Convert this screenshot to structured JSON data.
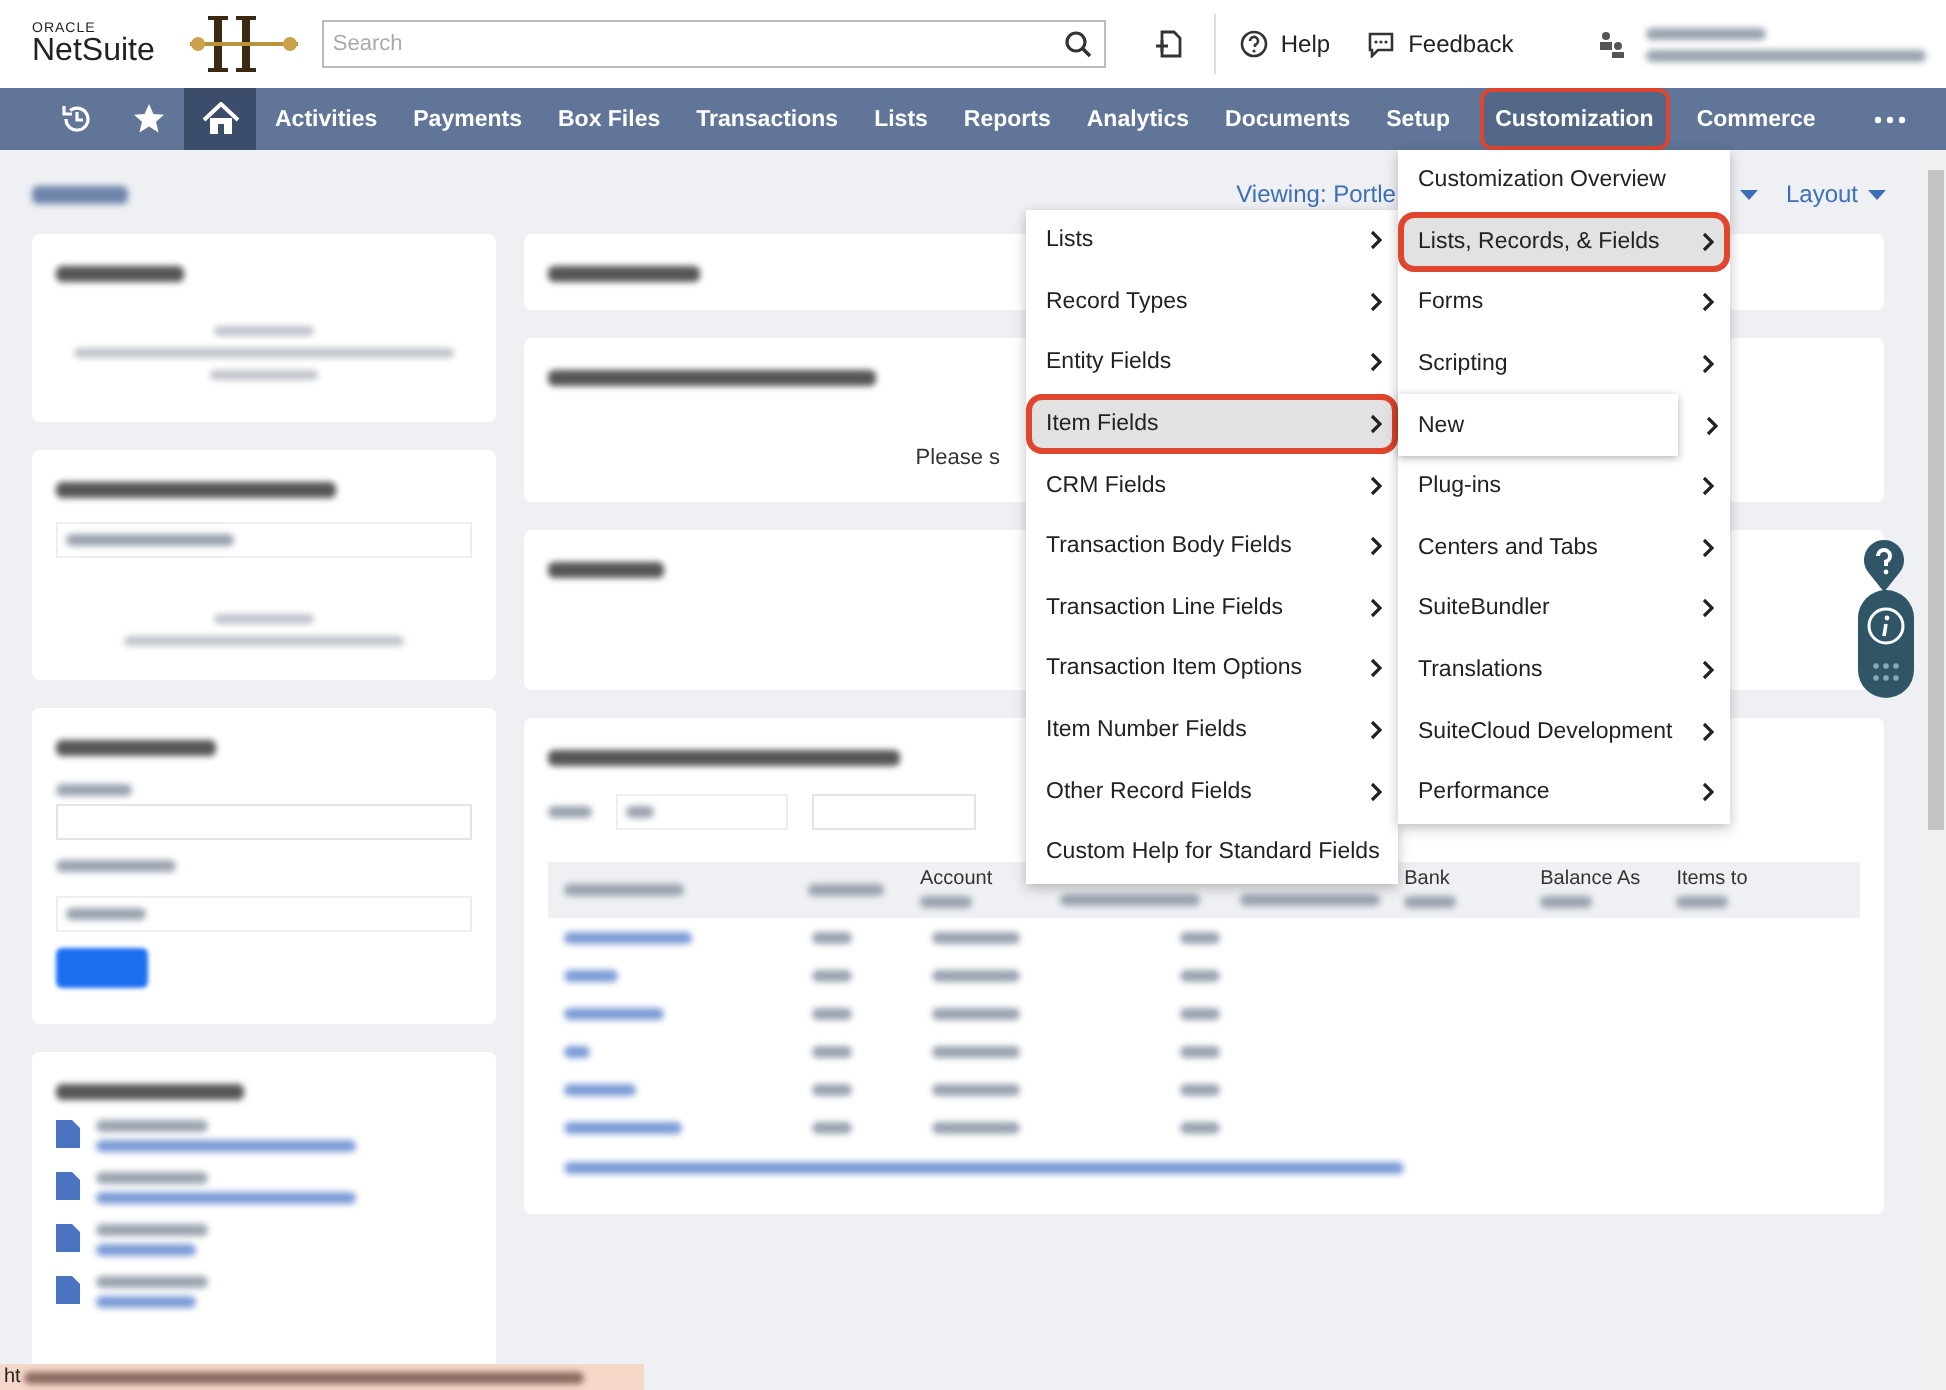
{
  "header": {
    "logo_top": "ORACLE",
    "logo_bottom": "NetSuite",
    "search": {
      "placeholder": "Search"
    },
    "links": [
      {
        "label": "Help",
        "kind": "help"
      },
      {
        "label": "Feedback",
        "kind": "chat"
      }
    ]
  },
  "nav": {
    "icons": [
      {
        "kind": "recent",
        "selected": false
      },
      {
        "kind": "star",
        "selected": false
      },
      {
        "kind": "home",
        "selected": true
      }
    ],
    "items": [
      {
        "label": "Activities",
        "selected": false,
        "highlighted": false
      },
      {
        "label": "Payments",
        "selected": false,
        "highlighted": false
      },
      {
        "label": "Box Files",
        "selected": false,
        "highlighted": false
      },
      {
        "label": "Transactions",
        "selected": false,
        "highlighted": false
      },
      {
        "label": "Lists",
        "selected": false,
        "highlighted": false
      },
      {
        "label": "Reports",
        "selected": false,
        "highlighted": false
      },
      {
        "label": "Analytics",
        "selected": false,
        "highlighted": false
      },
      {
        "label": "Documents",
        "selected": false,
        "highlighted": false
      },
      {
        "label": "Setup",
        "selected": false,
        "highlighted": false
      },
      {
        "label": "Customization",
        "selected": true,
        "highlighted": true
      },
      {
        "label": "Commerce",
        "selected": false,
        "highlighted": false
      }
    ]
  },
  "page": {
    "viewing": "Viewing: Portle",
    "layout": "Layout",
    "kpi_message": "Please s",
    "table_headers": [
      {
        "label": "Account"
      },
      {
        "label": "Bank"
      },
      {
        "label": "Balance As"
      },
      {
        "label": "Items to"
      }
    ]
  },
  "menus": [
    {
      "items": [
        {
          "label": "Lists",
          "submenu": true,
          "selected": false,
          "highlighted": false
        },
        {
          "label": "Record Types",
          "submenu": true,
          "selected": false,
          "highlighted": false
        },
        {
          "label": "Entity Fields",
          "submenu": true,
          "selected": false,
          "highlighted": false
        },
        {
          "label": "Item Fields",
          "submenu": true,
          "selected": true,
          "highlighted": true
        },
        {
          "label": "CRM Fields",
          "submenu": true,
          "selected": false,
          "highlighted": false
        },
        {
          "label": "Transaction Body Fields",
          "submenu": true,
          "selected": false,
          "highlighted": false
        },
        {
          "label": "Transaction Line Fields",
          "submenu": true,
          "selected": false,
          "highlighted": false
        },
        {
          "label": "Transaction Item Options",
          "submenu": true,
          "selected": false,
          "highlighted": false
        },
        {
          "label": "Item Number Fields",
          "submenu": true,
          "selected": false,
          "highlighted": false
        },
        {
          "label": "Other Record Fields",
          "submenu": true,
          "selected": false,
          "highlighted": false
        },
        {
          "label": "Custom Help for Standard Fields",
          "submenu": false,
          "selected": false,
          "highlighted": false
        }
      ]
    },
    {
      "items": [
        {
          "label": "Customization Overview",
          "submenu": false,
          "selected": false,
          "highlighted": false
        },
        {
          "label": "Lists, Records, & Fields",
          "submenu": true,
          "selected": true,
          "highlighted": true
        },
        {
          "label": "Forms",
          "submenu": true,
          "selected": false,
          "highlighted": false
        },
        {
          "label": "Scripting",
          "submenu": true,
          "selected": false,
          "highlighted": false
        },
        {
          "label": "New",
          "submenu": true,
          "selected": false,
          "highlighted": false,
          "hovered": true
        },
        {
          "label": "Plug-ins",
          "submenu": true,
          "selected": false,
          "highlighted": false
        },
        {
          "label": "Centers and Tabs",
          "submenu": true,
          "selected": false,
          "highlighted": false
        },
        {
          "label": "SuiteBundler",
          "submenu": true,
          "selected": false,
          "highlighted": false
        },
        {
          "label": "Translations",
          "submenu": true,
          "selected": false,
          "highlighted": false
        },
        {
          "label": "SuiteCloud Development",
          "submenu": true,
          "selected": false,
          "highlighted": false
        },
        {
          "label": "Performance",
          "submenu": true,
          "selected": false,
          "highlighted": false
        }
      ]
    }
  ],
  "status_bar": {
    "url": "ht"
  }
}
